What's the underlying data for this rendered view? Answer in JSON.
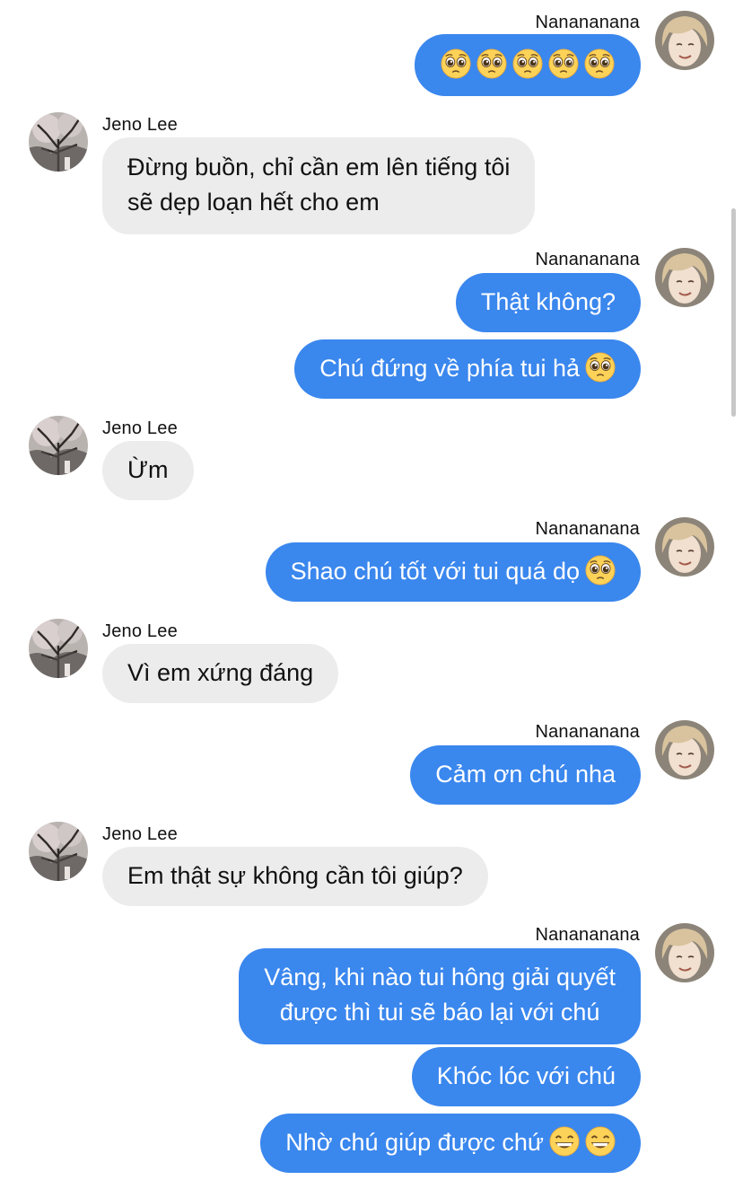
{
  "colors": {
    "outgoing_bubble": "#3a87ee",
    "incoming_bubble": "#ececec",
    "background": "#ffffff"
  },
  "participants": {
    "me": {
      "name": "Nanananana",
      "avatar_icon": "blonde-person-avatar"
    },
    "other": {
      "name": "Jeno Lee",
      "avatar_icon": "cherry-blossom-tree-avatar"
    }
  },
  "messages": [
    {
      "sender": "me",
      "emoji": [
        "pleading-face-emoji",
        "pleading-face-emoji",
        "pleading-face-emoji",
        "pleading-face-emoji",
        "pleading-face-emoji"
      ]
    },
    {
      "sender": "other",
      "lines": [
        "Đừng buồn, chỉ cần em lên tiếng tôi",
        "sẽ dẹp loạn hết cho em"
      ]
    },
    {
      "sender": "me",
      "text": "Thật không?"
    },
    {
      "sender": "me",
      "text": "Chú đứng về phía tui hả",
      "emoji": [
        "pleading-face-emoji"
      ]
    },
    {
      "sender": "other",
      "text": "Ừm"
    },
    {
      "sender": "me",
      "text": "Shao chú tốt với tui quá dọ",
      "emoji": [
        "pleading-face-emoji"
      ]
    },
    {
      "sender": "other",
      "text": "Vì em xứng đáng"
    },
    {
      "sender": "me",
      "text": "Cảm ơn chú nha"
    },
    {
      "sender": "other",
      "text": "Em thật sự không cần tôi giúp?"
    },
    {
      "sender": "me",
      "lines": [
        "Vâng, khi nào tui hông giải quyết",
        "được thì tui sẽ báo lại với chú"
      ]
    },
    {
      "sender": "me",
      "text": "Khóc lóc với chú"
    },
    {
      "sender": "me",
      "text": "Nhờ chú giúp được chứ",
      "emoji": [
        "grinning-face-emoji",
        "grinning-face-emoji"
      ]
    }
  ]
}
